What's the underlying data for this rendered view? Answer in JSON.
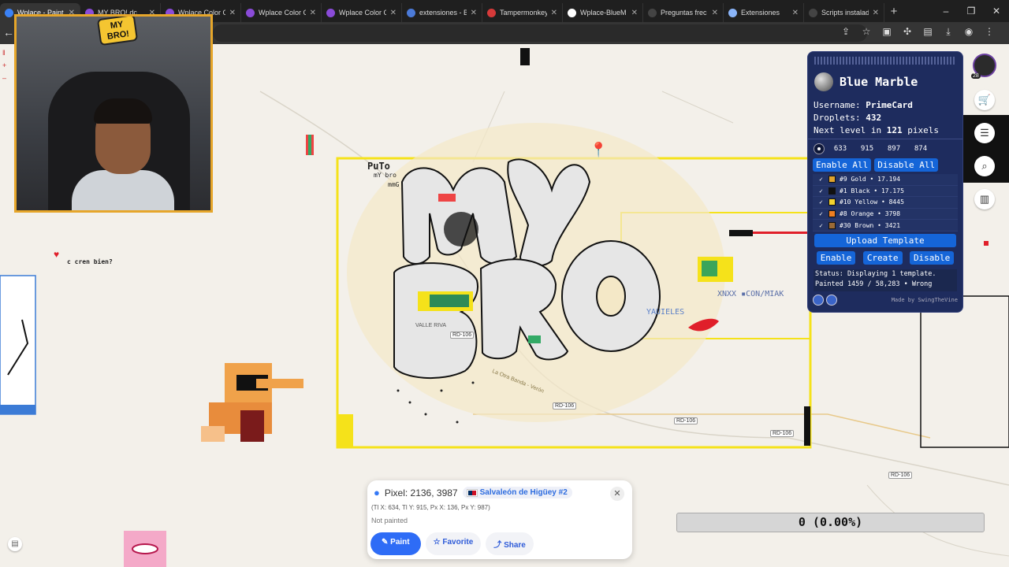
{
  "browser": {
    "tabs": [
      {
        "title": "Wplace - Paint",
        "color": "#3b82f6",
        "active": true
      },
      {
        "title": "MY BRO! dc",
        "color": "#8a4bd8",
        "active": false
      },
      {
        "title": "Wplace Color C",
        "color": "#8a4bd8",
        "active": false
      },
      {
        "title": "Wplace Color C",
        "color": "#8a4bd8",
        "active": false
      },
      {
        "title": "Wplace Color C",
        "color": "#8a4bd8",
        "active": false
      },
      {
        "title": "extensiones - B",
        "color": "#4b7ad8",
        "active": false
      },
      {
        "title": "Tampermonkey",
        "color": "#d63a3a",
        "active": false
      },
      {
        "title": "Wplace-BlueM",
        "color": "#ffffff",
        "active": false
      },
      {
        "title": "Preguntas frec",
        "color": "#444444",
        "active": false
      },
      {
        "title": "Extensiones",
        "color": "#8ab4f8",
        "active": false
      },
      {
        "title": "Scripts instalad",
        "color": "#444444",
        "active": false
      }
    ],
    "new_tab": "+",
    "window_controls": [
      "–",
      "❐",
      "✕"
    ]
  },
  "webcam": {
    "logo": "MY BRO!"
  },
  "blue_marble": {
    "title": "Blue Marble",
    "username_label": "Username:",
    "username": "PrimeCard",
    "droplets_label": "Droplets:",
    "droplets": "432",
    "next_level_prefix": "Next level in",
    "next_level_value": "121",
    "next_level_suffix": "pixels",
    "coords": [
      "633",
      "915",
      "897",
      "874"
    ],
    "enable_all": "Enable All",
    "disable_all": "Disable All",
    "colors": [
      {
        "label": "#9 Gold • 17.194",
        "swatch": "#e0a32e"
      },
      {
        "label": "#1 Black • 17.175",
        "swatch": "#111111"
      },
      {
        "label": "#10 Yellow • 8445",
        "swatch": "#f4d32f"
      },
      {
        "label": "#8 Orange • 3798",
        "swatch": "#ef7f22"
      },
      {
        "label": "#30 Brown • 3421",
        "swatch": "#9a6a36"
      }
    ],
    "upload_template": "Upload Template",
    "enable": "Enable",
    "create": "Create",
    "disable": "Disable",
    "status": "Status: Displaying 1 template. Painted 1459 / 58,283 • Wrong",
    "made_by": "Made by SwingTheVine"
  },
  "right_sidebar": {
    "level": "28"
  },
  "pixel_card": {
    "pixel": "Pixel: 2136, 3987",
    "place": "Salvaleón de Higüey #2",
    "tile_info": "(Tl X: 634, Tl Y: 915, Px X: 136, Px Y: 987)",
    "status": "Not painted",
    "paint": "Paint",
    "favorite": "Favorite",
    "share": "Share"
  },
  "progress": {
    "label": "0 (0.00%)"
  },
  "map_labels": {
    "roads": [
      "RD-106",
      "RD-106",
      "RD-106",
      "RD-106",
      "RD-106"
    ],
    "places": [
      "VALLE RIVA",
      "La Otra Banda - Verón"
    ],
    "art_text": [
      "PuTo",
      "mY bro",
      "mmG",
      "c cren bien?",
      "YAUIELES",
      "XNXX ▪CON/MIAK"
    ]
  },
  "colors": {
    "panel": "#1e2c5e",
    "accent": "#1565d8",
    "template_border": "#f5e21a"
  }
}
